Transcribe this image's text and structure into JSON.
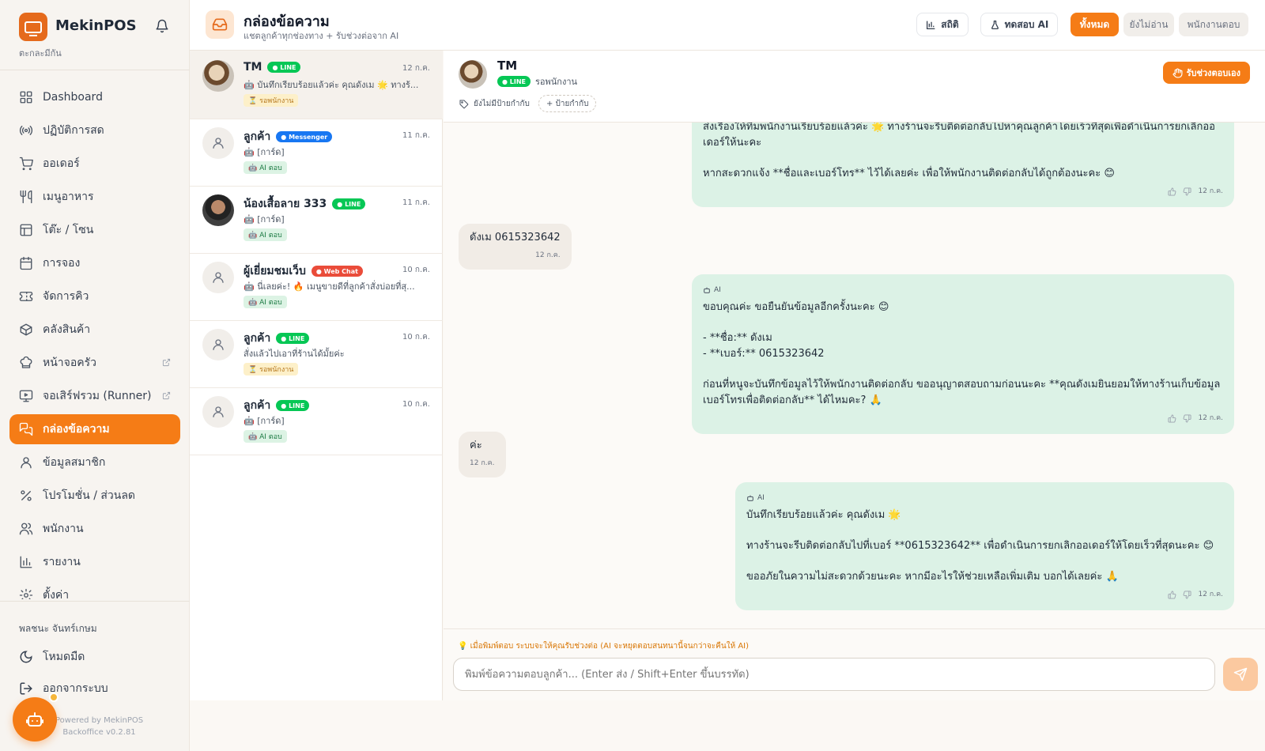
{
  "brand": {
    "name": "MekinPOS",
    "subtitle": "ตะกละมีกัน"
  },
  "sidebar": {
    "items": [
      {
        "label": "Dashboard",
        "icon": "grid-icon",
        "active": false
      },
      {
        "label": "ปฏิบัติการสด",
        "icon": "broadcast-icon",
        "active": false
      },
      {
        "label": "ออเดอร์",
        "icon": "cart-icon",
        "active": false
      },
      {
        "label": "เมนูอาหาร",
        "icon": "utensils-icon",
        "active": false
      },
      {
        "label": "โต๊ะ / โซน",
        "icon": "table-icon",
        "active": false
      },
      {
        "label": "การจอง",
        "icon": "calendar-icon",
        "active": false
      },
      {
        "label": "จัดการคิว",
        "icon": "ticket-icon",
        "active": false
      },
      {
        "label": "คลังสินค้า",
        "icon": "package-icon",
        "active": false
      },
      {
        "label": "หน้าจอครัว",
        "icon": "chef-hat-icon",
        "active": false,
        "external": true
      },
      {
        "label": "จอเสิร์ฟรวม (Runner)",
        "icon": "monitor-icon",
        "active": false,
        "external": true
      },
      {
        "label": "กล่องข้อความ",
        "icon": "chat-icon",
        "active": true
      },
      {
        "label": "ข้อมูลสมาชิก",
        "icon": "user-icon",
        "active": false
      },
      {
        "label": "โปรโมชั่น / ส่วนลด",
        "icon": "percent-icon",
        "active": false
      },
      {
        "label": "พนักงาน",
        "icon": "users-icon",
        "active": false
      },
      {
        "label": "รายงาน",
        "icon": "bar-chart-icon",
        "active": false
      },
      {
        "label": "ตั้งค่า",
        "icon": "settings-icon",
        "active": false
      }
    ],
    "user_name": "พลชนะ จันทร์เกษม",
    "dark_mode_label": "โหมดมืด",
    "logout_label": "ออกจากระบบ",
    "powered_line1": "Powered by MekinPOS",
    "powered_line2": "Backoffice v0.2.81"
  },
  "header": {
    "title": "กล่องข้อความ",
    "subtitle": "แชตลูกค้าทุกช่องทาง + รับช่วงต่อจาก AI",
    "stats_label": "สถิติ",
    "test_ai_label": "ทดสอบ AI",
    "filters": [
      "ทั้งหมด",
      "ยังไม่อ่าน",
      "พนักงานตอบ"
    ],
    "active_filter": "ทั้งหมด"
  },
  "conversations": [
    {
      "name": "TM",
      "channel": "LINE",
      "date": "12 ก.ค.",
      "preview": "🤖 บันทึกเรียบร้อยแล้วค่ะ คุณดังเม 🌟 ทางร้...",
      "tag": "⏳ รอพนักงาน",
      "tag_type": "wait",
      "selected": true,
      "avatar": "photo1"
    },
    {
      "name": "ลูกค้า",
      "channel": "Messenger",
      "date": "11 ก.ค.",
      "preview": "🤖 [การ์ด]",
      "tag": "🤖 AI ตอบ",
      "tag_type": "ai",
      "selected": false,
      "avatar": "default"
    },
    {
      "name": "น้องเสื้อลาย 333",
      "channel": "LINE",
      "date": "11 ก.ค.",
      "preview": "🤖 [การ์ด]",
      "tag": "🤖 AI ตอบ",
      "tag_type": "ai",
      "selected": false,
      "avatar": "photo2"
    },
    {
      "name": "ผู้เยี่ยมชมเว็บ",
      "channel": "Web Chat",
      "date": "10 ก.ค.",
      "preview": "🤖 นี่เลยค่ะ! 🔥 เมนูขายดีที่ลูกค้าสั่งบ่อยที่สุ...",
      "tag": "🤖 AI ตอบ",
      "tag_type": "ai",
      "selected": false,
      "avatar": "default"
    },
    {
      "name": "ลูกค้า",
      "channel": "LINE",
      "date": "10 ก.ค.",
      "preview": "สั่งแล้วไปเอาที่ร้านได้มั้ยค่ะ",
      "tag": "⏳ รอพนักงาน",
      "tag_type": "wait",
      "selected": false,
      "avatar": "default"
    },
    {
      "name": "ลูกค้า",
      "channel": "LINE",
      "date": "10 ก.ค.",
      "preview": "🤖 [การ์ด]",
      "tag": "🤖 AI ตอบ",
      "tag_type": "ai",
      "selected": false,
      "avatar": "default"
    }
  ],
  "chat": {
    "name": "TM",
    "channel": "LINE",
    "status": "รอพนักงาน",
    "tags_empty": "ยังไม่มีป้ายกำกับ",
    "add_tag": "+ ป้ายกำกับ",
    "takeover_label": "รับช่วงตอบเอง",
    "ai_label": "AI",
    "messages": [
      {
        "role": "ai",
        "show_label": false,
        "lines": [
          "ส่งเรื่องให้ทีมพนักงานเรียบร้อยแล้วค่ะ 🌟 ทางร้านจะรีบติดต่อกลับไปหาคุณลูกค้าโดยเร็วที่สุดเพื่อดำเนินการยกเลิกออ",
          "เดอร์ให้นะคะ",
          "",
          "หากสะดวกแจ้ง **ชื่อและเบอร์โทร** ไว้ได้เลยค่ะ เพื่อให้พนักงานติดต่อกลับได้ถูกต้องนะคะ 😊"
        ],
        "time": "12 ก.ค."
      },
      {
        "role": "user",
        "lines": [
          "ดังเม  0615323642"
        ],
        "time": "12 ก.ค."
      },
      {
        "role": "ai",
        "show_label": true,
        "lines": [
          "ขอบคุณค่ะ ขอยืนยันข้อมูลอีกครั้งนะคะ 😊",
          "",
          "- **ชื่อ:** ดังเม",
          "- **เบอร์:** 0615323642",
          "",
          "ก่อนที่หนูจะบันทึกข้อมูลไว้ให้พนักงานติดต่อกลับ ขออนุญาตสอบถามก่อนนะคะ **คุณดังเมยินยอมให้ทางร้านเก็บข้อมูล",
          "เบอร์โทรเพื่อติดต่อกลับ** ได้ไหมคะ? 🙏"
        ],
        "time": "12 ก.ค."
      },
      {
        "role": "user",
        "lines": [
          "ค่ะ"
        ],
        "time": "12 ก.ค."
      },
      {
        "role": "ai",
        "show_label": true,
        "lines": [
          "บันทึกเรียบร้อยแล้วค่ะ คุณดังเม 🌟",
          "",
          "ทางร้านจะรีบติดต่อกลับไปที่เบอร์ **0615323642** เพื่อดำเนินการยกเลิกออเดอร์ให้โดยเร็วที่สุดนะคะ 😊",
          "",
          "ขออภัยในความไม่สะดวกด้วยนะคะ หากมีอะไรให้ช่วยเหลือเพิ่มเติม บอกได้เลยค่ะ 🙏"
        ],
        "time": "12 ก.ค."
      }
    ]
  },
  "composer": {
    "hint": "💡 เมื่อพิมพ์ตอบ ระบบจะให้คุณรับช่วงต่อ (AI จะหยุดตอบสนทนานี้จนกว่าจะคืนให้ AI)",
    "placeholder": "พิมพ์ข้อความตอบลูกค้า... (Enter ส่ง / Shift+Enter ขึ้นบรรทัด)"
  },
  "colors": {
    "accent": "#f57c16",
    "ai_bubble": "#dcf2e6",
    "line": "#06c755",
    "messenger": "#1877f2",
    "webchat": "#ea4c3a"
  }
}
